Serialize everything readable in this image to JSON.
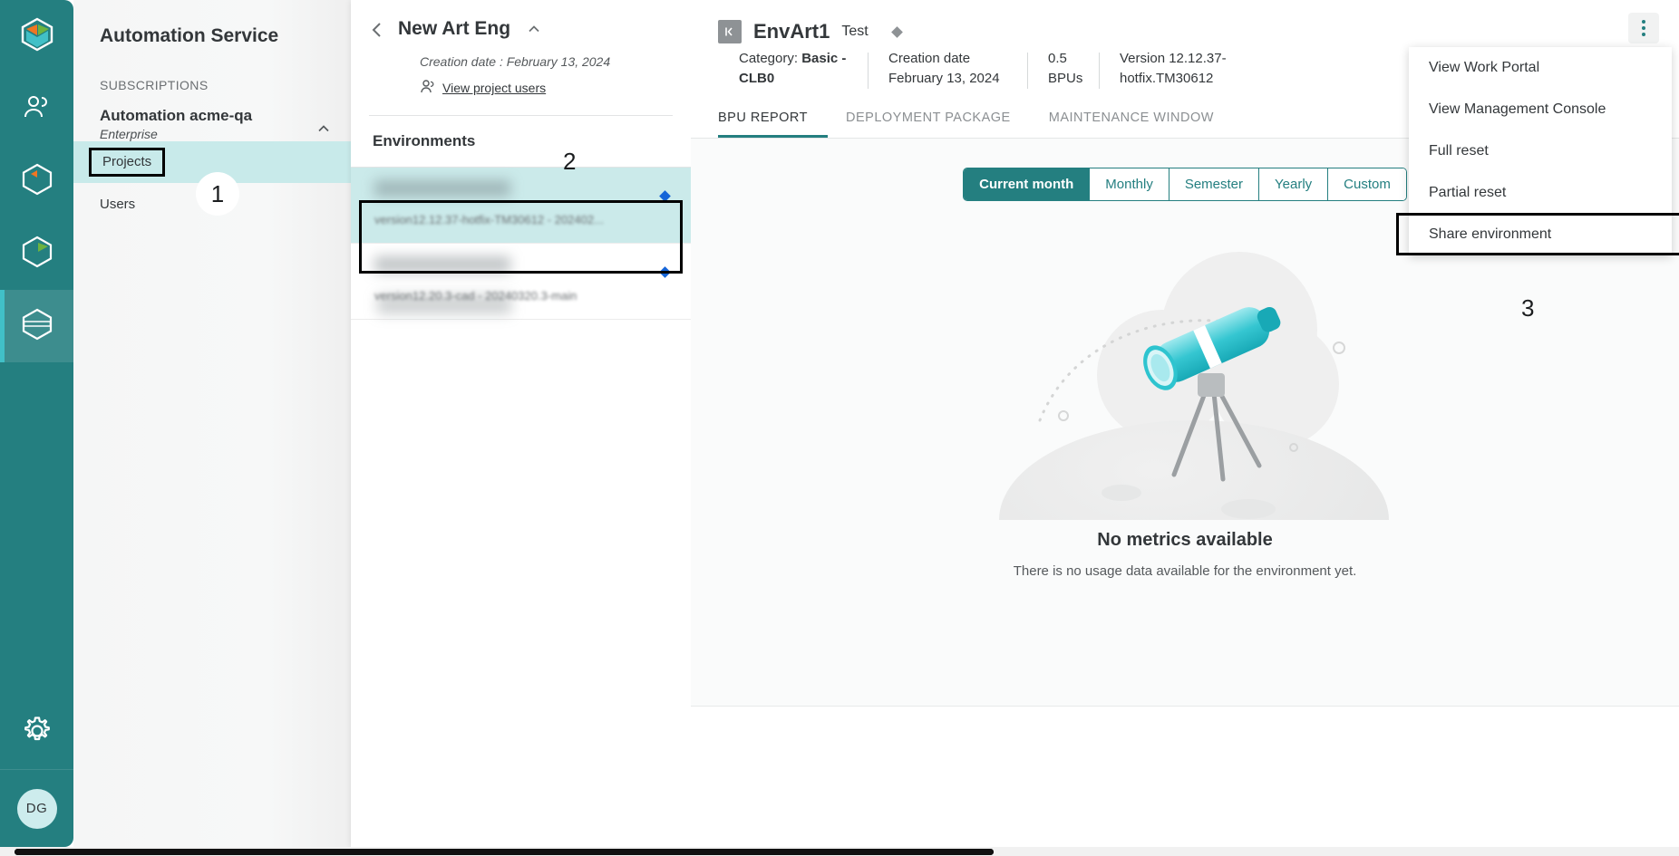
{
  "rail": {
    "items": [
      {
        "name": "logo",
        "icon": "cube-logo-icon"
      },
      {
        "name": "users",
        "icon": "people-icon"
      },
      {
        "name": "packages",
        "icon": "cube-orange-icon"
      },
      {
        "name": "reports",
        "icon": "cube-green-icon"
      },
      {
        "name": "environments",
        "icon": "cube-teal-icon",
        "active": true
      }
    ],
    "settings_icon": "gear-icon",
    "avatar_initials": "DG"
  },
  "subscriptions": {
    "app_title": "Automation Service",
    "section_label": "SUBSCRIPTIONS",
    "org_name": "Automation acme-qa",
    "org_plan": "Enterprise",
    "collapse_icon": "chevron-up-icon",
    "nav": [
      {
        "label": "Projects",
        "selected": true,
        "highlighted": true
      },
      {
        "label": "Users",
        "selected": false,
        "highlighted": false
      }
    ]
  },
  "annotations": [
    {
      "id": "1",
      "style": "circle"
    },
    {
      "id": "2",
      "style": "plain"
    },
    {
      "id": "3",
      "style": "plain"
    }
  ],
  "project": {
    "back_icon": "chevron-left-icon",
    "name": "New Art Eng",
    "caret_icon": "chevron-up-icon",
    "creation_date": "Creation date : February 13, 2024",
    "users_link": "View project users",
    "users_icon": "person-icon",
    "environments_header": "Environments",
    "environments": [
      {
        "name": "",
        "version": "version12.12.37-hotfix-TM30612 - 202402...",
        "selected": true,
        "status_color": "#1565d8",
        "blurred": true
      },
      {
        "name": "",
        "version": "version12.20.3-cad - 20240320.3-main",
        "selected": false,
        "status_color": "#1565d8",
        "blurred": true
      }
    ]
  },
  "environment": {
    "collapse_icon": "collapse-panel-icon",
    "title": "EnvArt1",
    "kind": "Test",
    "status_icon": "diamond-icon",
    "meta": [
      {
        "label": "Category:",
        "value": "Basic - CLB0"
      },
      {
        "label": "Creation date",
        "value": "February 13, 2024"
      },
      {
        "label": "",
        "value": "0.5 BPUs"
      },
      {
        "label": "",
        "value": "Version 12.12.37-hotfix.TM30612"
      }
    ],
    "category_prefix": "Category: ",
    "category_value": "Basic - CLB0",
    "creation_date": "Creation date February 13, 2024",
    "bpus": "0.5 BPUs",
    "version": "Version 12.12.37-hotfix.TM30612",
    "tabs": [
      {
        "label": "BPU REPORT",
        "active": true
      },
      {
        "label": "DEPLOYMENT PACKAGE",
        "active": false
      },
      {
        "label": "MAINTENANCE WINDOW",
        "active": false
      }
    ],
    "kebab_icon": "more-vertical-icon"
  },
  "period_filter": {
    "options": [
      {
        "label": "Current month",
        "active": true
      },
      {
        "label": "Monthly",
        "active": false
      },
      {
        "label": "Semester",
        "active": false
      },
      {
        "label": "Yearly",
        "active": false
      },
      {
        "label": "Custom",
        "active": false
      }
    ]
  },
  "empty_state": {
    "illustration": "telescope-illustration",
    "title": "No metrics available",
    "subtitle": "There is no usage data available for the environment yet."
  },
  "context_menu": {
    "items": [
      {
        "label": "View Work Portal",
        "highlighted": false
      },
      {
        "label": "View Management Console",
        "highlighted": false
      },
      {
        "label": "Full reset",
        "highlighted": false
      },
      {
        "label": "Partial reset",
        "highlighted": false
      },
      {
        "label": "Share environment",
        "highlighted": true
      }
    ]
  },
  "colors": {
    "brand_teal": "#247f80",
    "accent_cyan": "#41c0c7",
    "selection": "#c8eaea",
    "status_blue": "#1565d8"
  }
}
